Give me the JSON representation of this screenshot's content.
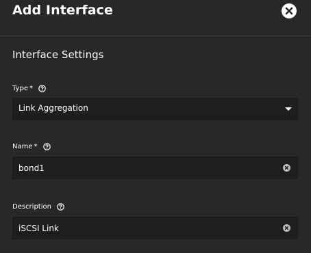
{
  "dialog": {
    "title": "Add Interface",
    "close_icon": "close-circle-icon"
  },
  "section": {
    "title": "Interface Settings"
  },
  "fields": {
    "type": {
      "label": "Type",
      "required_mark": "*",
      "help_icon": "help-circle-icon",
      "value": "Link Aggregation",
      "dropdown_icon": "caret-down-icon"
    },
    "name": {
      "label": "Name",
      "required_mark": "*",
      "help_icon": "help-circle-icon",
      "value": "bond1",
      "clear_icon": "clear-circle-icon"
    },
    "description": {
      "label": "Description",
      "help_icon": "help-circle-icon",
      "value": "iSCSI Link",
      "clear_icon": "clear-circle-icon"
    }
  },
  "colors": {
    "background": "#282828",
    "field_background": "#1e1e1e",
    "divider": "#3d3d3d",
    "text": "#ffffff"
  }
}
